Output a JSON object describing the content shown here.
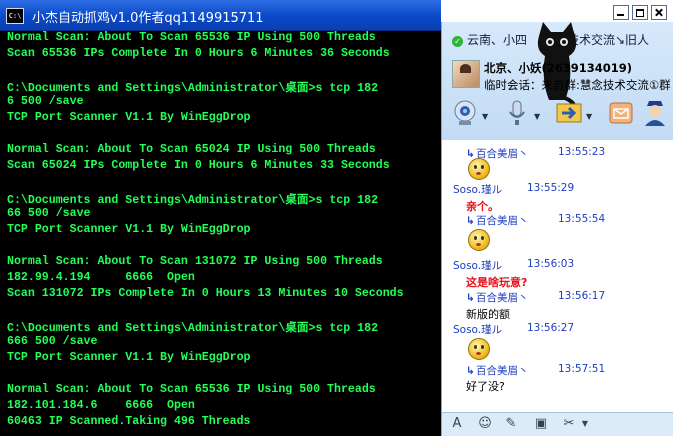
{
  "console": {
    "title": "小杰自动抓鸡v1.0作者qq1149915711",
    "lines": [
      "Normal Scan: About To Scan 65536 IP Using 500 Threads",
      "Scan 65536 IPs Complete In 0 Hours 6 Minutes 36 Seconds",
      "",
      "C:\\Documents and Settings\\Administrator\\桌面>s tcp 182",
      "6 500 /save",
      "TCP Port Scanner V1.1 By WinEggDrop",
      "",
      "Normal Scan: About To Scan 65024 IP Using 500 Threads",
      "Scan 65024 IPs Complete In 0 Hours 6 Minutes 33 Seconds",
      "",
      "C:\\Documents and Settings\\Administrator\\桌面>s tcp 182",
      "66 500 /save",
      "TCP Port Scanner V1.1 By WinEggDrop",
      "",
      "Normal Scan: About To Scan 131072 IP Using 500 Threads",
      "182.99.4.194     6666  Open",
      "Scan 131072 IPs Complete In 0 Hours 13 Minutes 10 Seconds",
      "",
      "C:\\Documents and Settings\\Administrator\\桌面>s tcp 182",
      "666 500 /save",
      "TCP Port Scanner V1.1 By WinEggDrop",
      "",
      "Normal Scan: About To Scan 65536 IP Using 500 Threads",
      "182.101.184.6    6666  Open",
      "60463 IP Scanned.Taking 496 Threads"
    ]
  },
  "chat": {
    "tabs": [
      "云南、小四",
      "技术交流↘旧人"
    ],
    "contact_name": "北京、小妖(2639134019)",
    "session_label": "临时会话：来自群:慧念技术交流①群",
    "messages": [
      {
        "sender": "百合美眉丶",
        "time": "13:55:23",
        "kind": "emoji"
      },
      {
        "sender": "Soso.瑾ル",
        "time": "13:55:29",
        "kind": "text",
        "text": "亲个。",
        "red": true
      },
      {
        "sender": "百合美眉丶",
        "time": "13:55:54",
        "kind": "emoji"
      },
      {
        "sender": "Soso.瑾ル",
        "time": "13:56:03",
        "kind": "text",
        "text": "这是啥玩意?",
        "red": true
      },
      {
        "sender": "百合美眉丶",
        "time": "13:56:17",
        "kind": "text",
        "text": "新版的额",
        "red": false
      },
      {
        "sender": "Soso.瑾ル",
        "time": "13:56:27",
        "kind": "emoji"
      },
      {
        "sender": "百合美眉丶",
        "time": "13:57:51",
        "kind": "text",
        "text": "好了没?",
        "red": false
      }
    ]
  }
}
